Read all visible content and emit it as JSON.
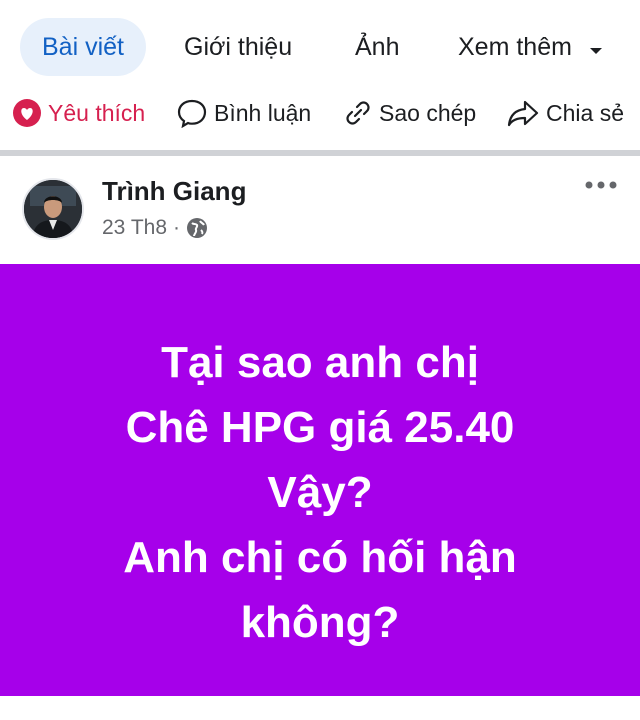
{
  "tabs": [
    {
      "label": "Bài viết",
      "active": true
    },
    {
      "label": "Giới thiệu",
      "active": false
    },
    {
      "label": "Ảnh",
      "active": false
    },
    {
      "label": "Xem thêm",
      "active": false
    }
  ],
  "actions": {
    "like": "Yêu thích",
    "comment": "Bình luận",
    "copy": "Sao chép",
    "share": "Chia sẻ"
  },
  "post": {
    "author": "Trình Giang",
    "date": "23 Th8",
    "dot": "·",
    "privacy_icon": "globe-icon",
    "lines": [
      "Tại sao anh chị",
      "Chê HPG giá 25.40",
      "Vậy?",
      "Anh chị có hối hận",
      "không?"
    ],
    "background_color": "#a600ea"
  },
  "colors": {
    "accent": "#1261c4",
    "tab_active_bg": "#e7f0fb",
    "like": "#d6204f"
  }
}
